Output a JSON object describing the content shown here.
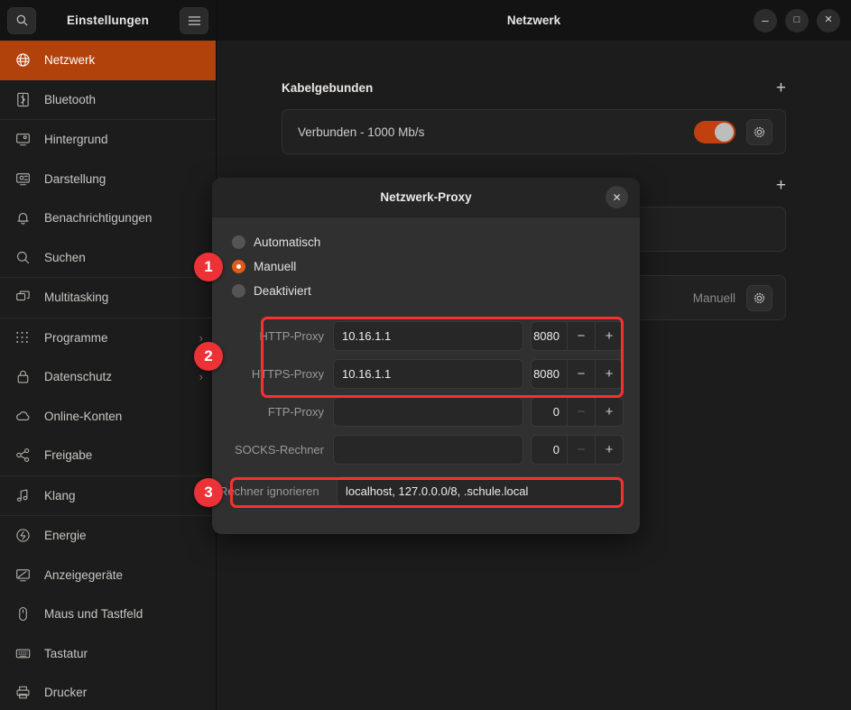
{
  "sidebar": {
    "title": "Einstellungen",
    "search_icon": "search-icon",
    "menu_icon": "hamburger-menu-icon",
    "items": [
      {
        "label": "Netzwerk",
        "icon": "globe-icon",
        "active": true,
        "chevron": ""
      },
      {
        "label": "Bluetooth",
        "icon": "bluetooth-icon",
        "active": false,
        "chevron": ""
      },
      {
        "label": "Hintergrund",
        "icon": "monitor-icon",
        "active": false,
        "chevron": ""
      },
      {
        "label": "Darstellung",
        "icon": "appearance-icon",
        "active": false,
        "chevron": ""
      },
      {
        "label": "Benachrichtigungen",
        "icon": "bell-icon",
        "active": false,
        "chevron": ""
      },
      {
        "label": "Suchen",
        "icon": "search-icon",
        "active": false,
        "chevron": ""
      },
      {
        "label": "Multitasking",
        "icon": "windows-icon",
        "active": false,
        "chevron": ""
      },
      {
        "label": "Programme",
        "icon": "grid-apps-icon",
        "active": false,
        "chevron": "›"
      },
      {
        "label": "Datenschutz",
        "icon": "lock-icon",
        "active": false,
        "chevron": "›"
      },
      {
        "label": "Online-Konten",
        "icon": "cloud-icon",
        "active": false,
        "chevron": ""
      },
      {
        "label": "Freigabe",
        "icon": "share-icon",
        "active": false,
        "chevron": ""
      },
      {
        "label": "Klang",
        "icon": "music-note-icon",
        "active": false,
        "chevron": ""
      },
      {
        "label": "Energie",
        "icon": "power-icon",
        "active": false,
        "chevron": ""
      },
      {
        "label": "Anzeigegeräte",
        "icon": "display-icon",
        "active": false,
        "chevron": ""
      },
      {
        "label": "Maus und Tastfeld",
        "icon": "mouse-icon",
        "active": false,
        "chevron": ""
      },
      {
        "label": "Tastatur",
        "icon": "keyboard-icon",
        "active": false,
        "chevron": ""
      },
      {
        "label": "Drucker",
        "icon": "printer-icon",
        "active": false,
        "chevron": ""
      }
    ]
  },
  "main": {
    "title": "Netzwerk",
    "window_controls": {
      "minimize": "–",
      "maximize": "□",
      "close": "✕"
    },
    "sections": [
      {
        "heading": "Kabelgebunden",
        "add_label": "+",
        "row_label": "Verbunden - 1000 Mb/s",
        "toggle_on": true
      },
      {
        "heading": "",
        "add_label": "+",
        "row_label": "",
        "toggle_on": false
      }
    ],
    "proxy_row": {
      "value": "Manuell",
      "gear_icon": "gear-icon"
    }
  },
  "dialog": {
    "title": "Netzwerk-Proxy",
    "close_label": "✕",
    "modes": [
      {
        "label": "Automatisch",
        "selected": false
      },
      {
        "label": "Manuell",
        "selected": true
      },
      {
        "label": "Deaktiviert",
        "selected": false
      }
    ],
    "fields": [
      {
        "label": "HTTP-Proxy",
        "host": "10.16.1.1",
        "port": "8080",
        "dim": false
      },
      {
        "label": "HTTPS-Proxy",
        "host": "10.16.1.1",
        "port": "8080",
        "dim": false
      },
      {
        "label": "FTP-Proxy",
        "host": "",
        "port": "0",
        "dim": true
      },
      {
        "label": "SOCKS-Rechner",
        "host": "",
        "port": "0",
        "dim": true
      }
    ],
    "ignore": {
      "label": "Rechner ignorieren",
      "value": "localhost, 127.0.0.0/8, .schule.local"
    },
    "stepper": {
      "minus": "−",
      "plus": "+"
    }
  },
  "annotations": {
    "accent_color": "#ec3237",
    "badges": [
      {
        "number": "1"
      },
      {
        "number": "2"
      },
      {
        "number": "3"
      }
    ]
  }
}
